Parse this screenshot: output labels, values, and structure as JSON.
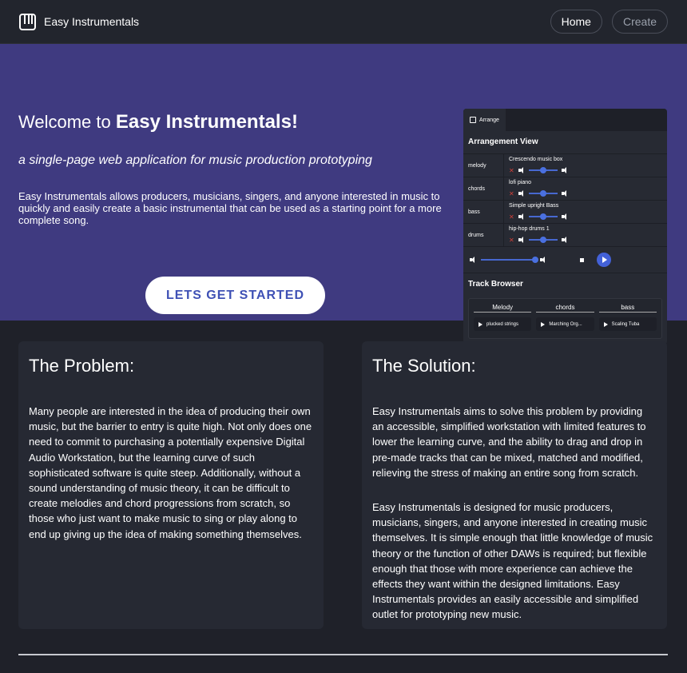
{
  "nav": {
    "brand_name": "Easy Instrumentals",
    "links": [
      {
        "label": "Home"
      },
      {
        "label": "Create"
      }
    ]
  },
  "hero": {
    "title_prefix": "Welcome to ",
    "title_bold": "Easy Instrumentals!",
    "subtitle": "a single-page web application for music production prototyping",
    "description": "Easy Instrumentals allows producers, musicians, singers, and anyone interested in music to quickly and easily create a basic instrumental that can be used as a starting point for a more complete song.",
    "cta_label": "LETS GET STARTED"
  },
  "preview": {
    "tab_label": "Arrange",
    "arrangement_title": "Arrangement View",
    "tracks": [
      {
        "name": "melody",
        "clip": "Crescendo music box",
        "volume": 0.5
      },
      {
        "name": "chords",
        "clip": "lofi piano",
        "volume": 0.5
      },
      {
        "name": "bass",
        "clip": "Simple upright Bass",
        "volume": 0.5
      },
      {
        "name": "drums",
        "clip": "hip-hop drums 1",
        "volume": 0.5
      }
    ],
    "master_volume": 1.0,
    "browser_title": "Track Browser",
    "browser_columns": [
      {
        "head": "Melody",
        "item": "plucked strings"
      },
      {
        "head": "chords",
        "item": "Marching Org..."
      },
      {
        "head": "bass",
        "item": "Scaling Tuba"
      }
    ],
    "accent_color": "#4361d8"
  },
  "problem": {
    "title": "The Problem:",
    "text": "Many people are interested in the idea of producing their own music, but the barrier to entry is quite high. Not only does one need to commit to purchasing a potentially expensive Digital Audio Workstation, but the learning curve of such sophisticated software is quite steep. Additionally, without a sound understanding of music theory, it can be difficult to create melodies and chord progressions from scratch, so those who just want to make music to sing or play along to end up giving up the idea of making something themselves."
  },
  "solution": {
    "title": "The Solution:",
    "text1": "Easy Instrumentals aims to solve this problem by providing an accessible, simplified workstation with limited features to lower the learning curve, and the ability to drag and drop in pre-made tracks that can be mixed, matched and modified, relieving the stress of making an entire song from scratch.",
    "text2": "Easy Instrumentals is designed for music producers, musicians, singers, and anyone interested in creating music themselves. It is simple enough that little knowledge of music theory or the function of other DAWs is required; but flexible enough that those with more experience can achieve the effects they want within the designed limitations. Easy Instrumentals provides an easily accessible and simplified outlet for prototyping new music."
  },
  "colors": {
    "hero_bg": "#3f3a80",
    "page_bg": "#1f2129",
    "card_bg": "#262933",
    "cta_text": "#3f51b5"
  }
}
